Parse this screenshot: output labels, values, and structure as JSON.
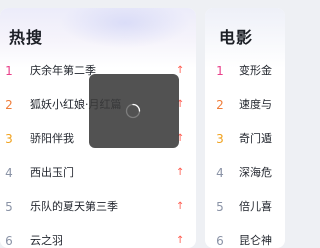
{
  "colors": {
    "rank_top1": "#e9408a",
    "rank_top2": "#f07d3a",
    "rank_top3": "#f0a21e",
    "rank_default": "#8a93a6",
    "trend_up": "#ff5a4e"
  },
  "hot": {
    "title": "热搜",
    "items": [
      {
        "rank": "1",
        "title": "庆余年第二季",
        "trend_icon": "arrow-up-icon",
        "trend": "↑"
      },
      {
        "rank": "2",
        "title": "狐妖小红娘·月红篇",
        "trend_icon": "arrow-up-icon",
        "trend": "↑"
      },
      {
        "rank": "3",
        "title": "骄阳伴我",
        "trend_icon": "arrow-up-icon",
        "trend": "↑"
      },
      {
        "rank": "4",
        "title": "西出玉门",
        "trend_icon": "arrow-up-icon",
        "trend": "↑"
      },
      {
        "rank": "5",
        "title": "乐队的夏天第三季",
        "trend_icon": "arrow-up-icon",
        "trend": "↑"
      },
      {
        "rank": "6",
        "title": "云之羽",
        "trend_icon": "arrow-up-icon",
        "trend": "↑"
      }
    ]
  },
  "movie": {
    "title": "电影",
    "items": [
      {
        "rank": "1",
        "title": "变形金"
      },
      {
        "rank": "2",
        "title": "速度与"
      },
      {
        "rank": "3",
        "title": "奇门遁"
      },
      {
        "rank": "4",
        "title": "深海危"
      },
      {
        "rank": "5",
        "title": "倍儿喜"
      },
      {
        "rank": "6",
        "title": "昆仑神"
      }
    ]
  },
  "loading": {
    "icon": "loading-spinner-icon"
  }
}
